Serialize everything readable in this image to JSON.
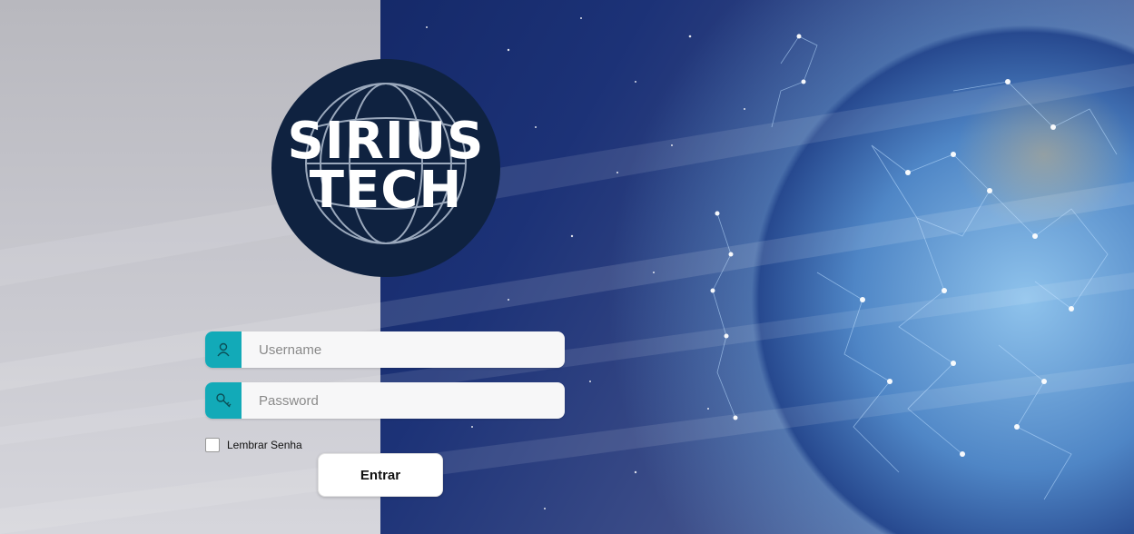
{
  "logo": {
    "line1": "SIRIUS",
    "line2": "TECH"
  },
  "login": {
    "username_placeholder": "Username",
    "password_placeholder": "Password",
    "remember_label": "Lembrar Senha",
    "submit_label": "Entrar"
  },
  "icons": {
    "username": "user-icon",
    "password": "key-icon"
  },
  "colors": {
    "accent": "#12aab8",
    "logo_bg": "#0f2240",
    "left_panel": "#c4c4cb"
  }
}
